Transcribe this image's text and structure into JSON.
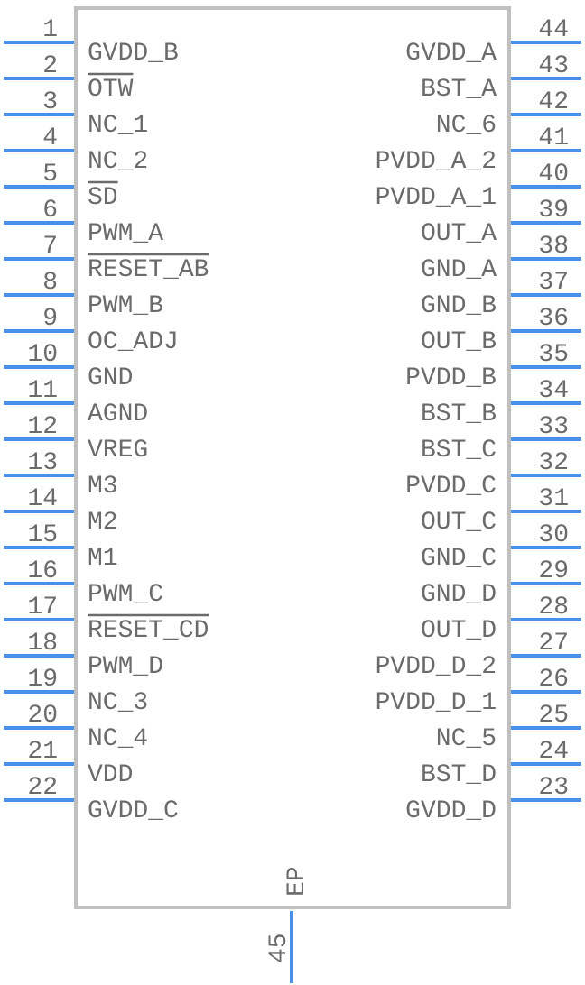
{
  "component": {
    "exposed_pad_label": "EP",
    "exposed_pad_pin": "45",
    "colors": {
      "pin": "#4a90e8",
      "outline": "#c0c0c0",
      "text": "#6b6b6b"
    }
  },
  "left_pins": [
    {
      "num": "1",
      "name": "GVDD_B"
    },
    {
      "num": "2",
      "name": "OTW",
      "active_low": true
    },
    {
      "num": "3",
      "name": "NC_1"
    },
    {
      "num": "4",
      "name": "NC_2"
    },
    {
      "num": "5",
      "name": "SD",
      "active_low": true
    },
    {
      "num": "6",
      "name": "PWM_A"
    },
    {
      "num": "7",
      "name": "RESET_AB",
      "active_low": true
    },
    {
      "num": "8",
      "name": "PWM_B"
    },
    {
      "num": "9",
      "name": "OC_ADJ"
    },
    {
      "num": "10",
      "name": "GND"
    },
    {
      "num": "11",
      "name": "AGND"
    },
    {
      "num": "12",
      "name": "VREG"
    },
    {
      "num": "13",
      "name": "M3"
    },
    {
      "num": "14",
      "name": "M2"
    },
    {
      "num": "15",
      "name": "M1"
    },
    {
      "num": "16",
      "name": "PWM_C"
    },
    {
      "num": "17",
      "name": "RESET_CD",
      "active_low": true
    },
    {
      "num": "18",
      "name": "PWM_D"
    },
    {
      "num": "19",
      "name": "NC_3"
    },
    {
      "num": "20",
      "name": "NC_4"
    },
    {
      "num": "21",
      "name": "VDD"
    },
    {
      "num": "22",
      "name": "GVDD_C"
    }
  ],
  "right_pins": [
    {
      "num": "44",
      "name": "GVDD_A"
    },
    {
      "num": "43",
      "name": "BST_A"
    },
    {
      "num": "42",
      "name": "NC_6"
    },
    {
      "num": "41",
      "name": "PVDD_A_2"
    },
    {
      "num": "40",
      "name": "PVDD_A_1"
    },
    {
      "num": "39",
      "name": "OUT_A"
    },
    {
      "num": "38",
      "name": "GND_A"
    },
    {
      "num": "37",
      "name": "GND_B"
    },
    {
      "num": "36",
      "name": "OUT_B"
    },
    {
      "num": "35",
      "name": "PVDD_B"
    },
    {
      "num": "34",
      "name": "BST_B"
    },
    {
      "num": "33",
      "name": "BST_C"
    },
    {
      "num": "32",
      "name": "PVDD_C"
    },
    {
      "num": "31",
      "name": "OUT_C"
    },
    {
      "num": "30",
      "name": "GND_C"
    },
    {
      "num": "29",
      "name": "GND_D"
    },
    {
      "num": "28",
      "name": "OUT_D"
    },
    {
      "num": "27",
      "name": "PVDD_D_2"
    },
    {
      "num": "26",
      "name": "PVDD_D_1"
    },
    {
      "num": "25",
      "name": "NC_5"
    },
    {
      "num": "24",
      "name": "BST_D"
    },
    {
      "num": "23",
      "name": "GVDD_D"
    }
  ]
}
